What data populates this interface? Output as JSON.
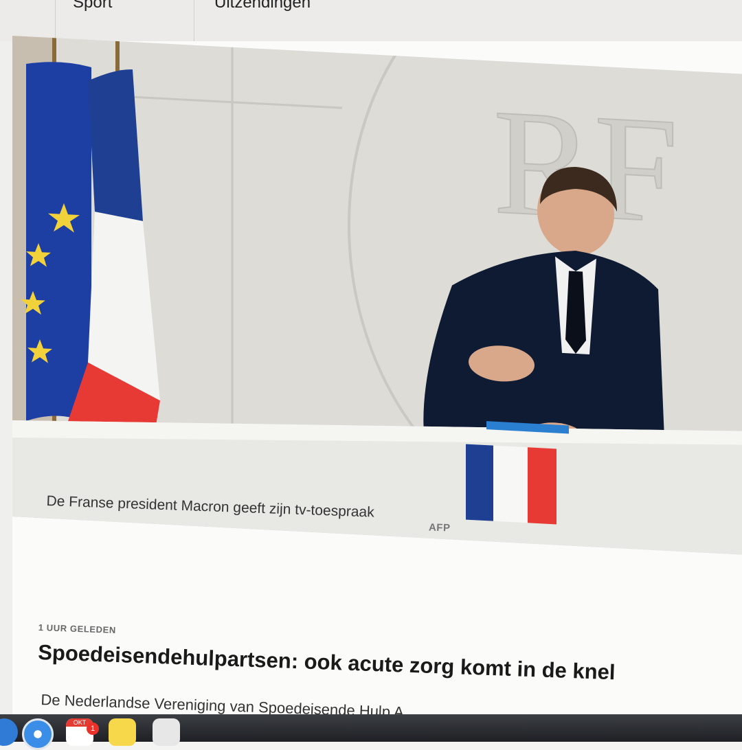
{
  "nav": {
    "items": [
      "Sport",
      "Uitzendingen"
    ]
  },
  "article": {
    "photo_alt": "De Franse president Macron geeft zijn tv-toespraak",
    "caption": "De Franse president Macron geeft zijn tv-toespraak",
    "credit": "AFP",
    "meta_time": "1 UUR GELEDEN",
    "headline": "Spoedeisendehulpartsen: ook acute zorg komt in de knel",
    "lead": "De Nederlandse Vereniging van Spoedeisende Hulp A"
  },
  "dock": {
    "calendar_month": "OKT",
    "calendar_badge": "1",
    "apps": [
      "finder-icon",
      "safari-icon",
      "calendar-icon",
      "notes-icon",
      "files-icon"
    ]
  },
  "colors": {
    "flag_blue": "#1f3f93",
    "flag_red": "#e83a35",
    "eu_blue": "#1d3ea3",
    "eu_star": "#f2d23a",
    "suit": "#0f1a33",
    "background": "#dcdcd8"
  }
}
